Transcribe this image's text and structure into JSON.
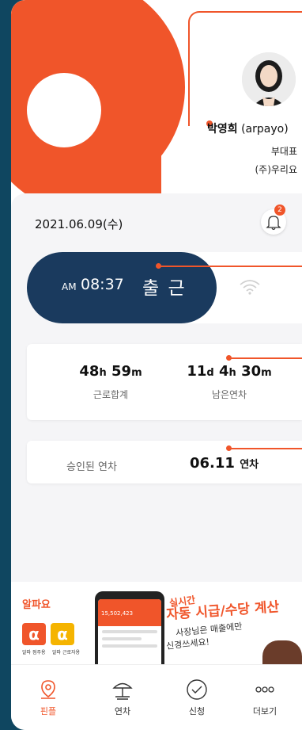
{
  "profile": {
    "name": "박영희",
    "username": "(arpayo)",
    "role": "부대표",
    "company": "(주)우리요"
  },
  "date": "2021.06.09(수)",
  "notification_count": "2",
  "punch": {
    "ampm": "AM",
    "time": "08:37",
    "status": "출 근"
  },
  "stats": [
    {
      "value": "48",
      "unit1": "h",
      "value2": "59",
      "unit2": "m",
      "label": "근로합계"
    },
    {
      "value": "11",
      "unit1": "d",
      "value2": "4",
      "unit2": "h",
      "value3": "30",
      "unit3": "m",
      "label": "남은연차"
    }
  ],
  "approved": {
    "label": "승인된 연차",
    "date": "06.11",
    "kind": "연차"
  },
  "banner": {
    "logo": "알파요",
    "tile1_caption": "알파 점주용",
    "tile2_caption": "알파 근로자용",
    "phone_amount": "15,502,423",
    "headline1": "실시간",
    "headline2": "자동 시급/수당 계산",
    "sub1": "사장님은 매출에만",
    "sub2": "신경쓰세요!"
  },
  "tabs": [
    {
      "label": "핀플",
      "icon": "map-pin-icon",
      "active": true
    },
    {
      "label": "연차",
      "icon": "beach-umbrella-icon",
      "active": false
    },
    {
      "label": "신청",
      "icon": "check-circle-icon",
      "active": false
    },
    {
      "label": "더보기",
      "icon": "more-dots-icon",
      "active": false
    }
  ],
  "colors": {
    "accent": "#f0552a",
    "navy": "#1a3a5e",
    "background": "#0f4660"
  }
}
